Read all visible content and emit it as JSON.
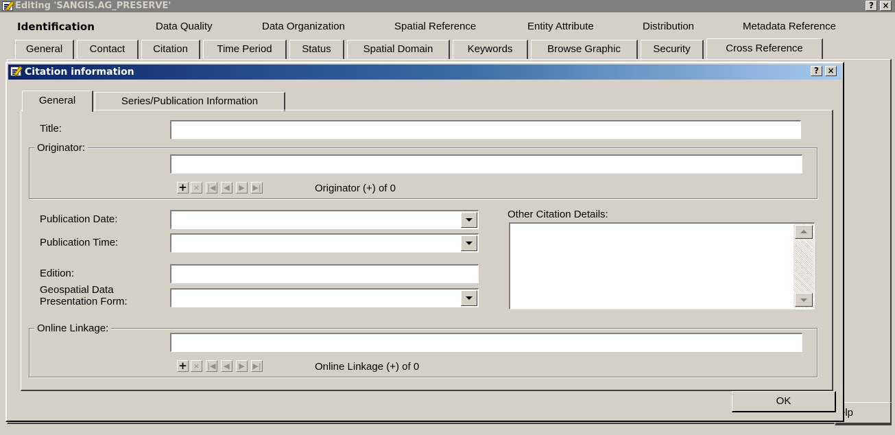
{
  "window": {
    "title": "Editing 'SANGIS.AG_PRESERVE'",
    "help_label": "?",
    "close_label": "×"
  },
  "sections": [
    "Identification",
    "Data Quality",
    "Data Organization",
    "Spatial Reference",
    "Entity Attribute",
    "Distribution",
    "Metadata Reference"
  ],
  "outer_tabs": [
    "General",
    "Contact",
    "Citation",
    "Time Period",
    "Status",
    "Spatial Domain",
    "Keywords",
    "Browse Graphic",
    "Security",
    "Cross Reference"
  ],
  "outer_help_button": "elp",
  "dialog": {
    "title": "Citation information",
    "help_label": "?",
    "close_label": "×",
    "tabs": [
      "General",
      "Series/Publication Information"
    ],
    "ok_label": "OK",
    "fields": {
      "title_label": "Title:",
      "title_value": "",
      "originator_label": "Originator:",
      "originator_value": "",
      "originator_count": "Originator (+) of 0",
      "pub_date_label": "Publication Date:",
      "pub_date_value": "",
      "pub_time_label": "Publication Time:",
      "pub_time_value": "",
      "edition_label": "Edition:",
      "edition_value": "",
      "geo_form_label_1": "Geospatial Data",
      "geo_form_label_2": "Presentation Form:",
      "geo_form_value": "",
      "other_details_label": "Other Citation Details:",
      "other_details_value": "",
      "online_linkage_label": "Online Linkage:",
      "online_linkage_value": "",
      "online_linkage_count": "Online Linkage (+) of 0"
    },
    "nav_buttons": {
      "add": "+",
      "delete": "×",
      "first": "|◀",
      "prev": "◀",
      "next": "▶",
      "last": "▶|"
    }
  },
  "colors": {
    "dialog_title_gradient_start": "#0a246a",
    "dialog_title_gradient_end": "#a6caf0",
    "inactive_title": "#808080",
    "face": "#d4d0c8"
  }
}
